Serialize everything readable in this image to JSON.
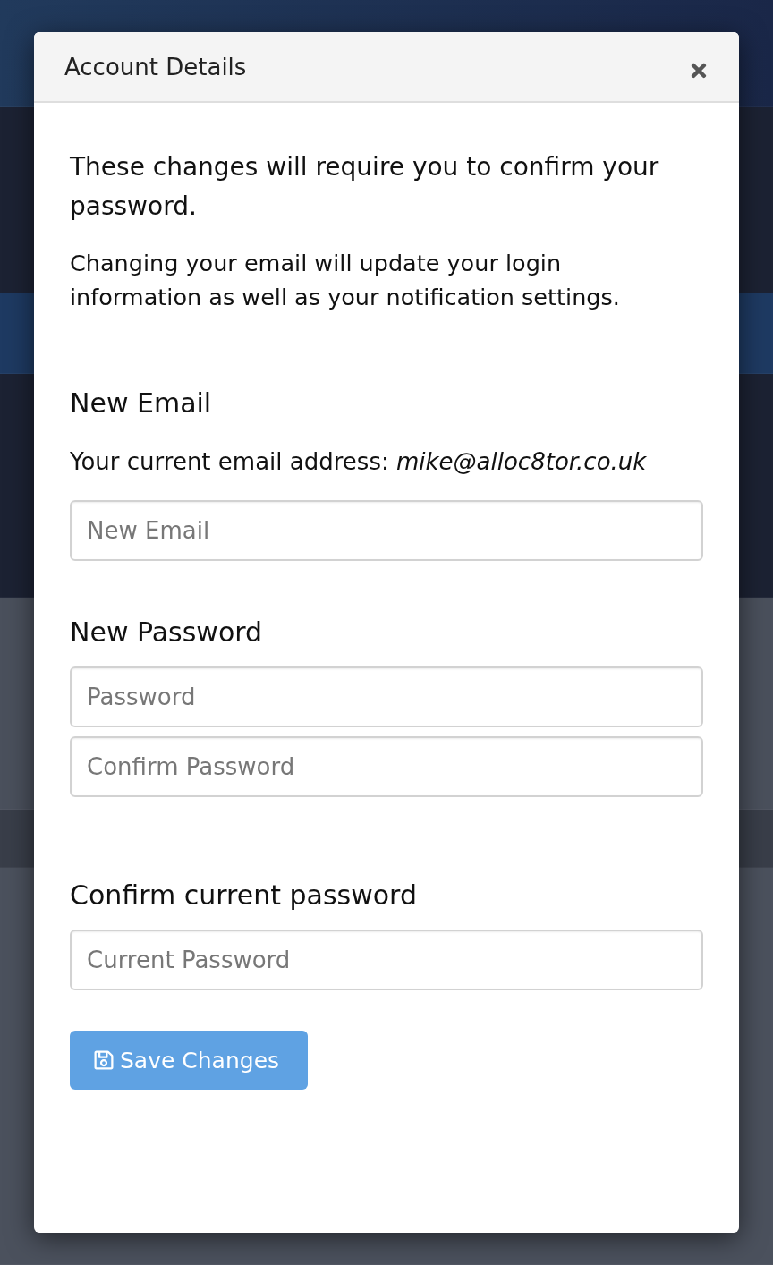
{
  "modal": {
    "title": "Account Details"
  },
  "heading": "These changes will require you to confirm your password.",
  "intro": "Changing your email will update your login information as well as your notification settings.",
  "sections": [
    {
      "heading": "New Email",
      "note": "Your current email address: *mike@alloc8tor.co.uk*",
      "fields": [
        {
          "placeholder": "New Email"
        }
      ]
    },
    {
      "heading": "New Password",
      "fields": [
        {
          "placeholder": "Password"
        },
        {
          "placeholder": "Confirm Password"
        }
      ]
    },
    {
      "heading": "Confirm current password",
      "fields": [
        {
          "placeholder": "Current Password"
        }
      ]
    }
  ],
  "save_button": {
    "label": "Save Changes"
  }
}
